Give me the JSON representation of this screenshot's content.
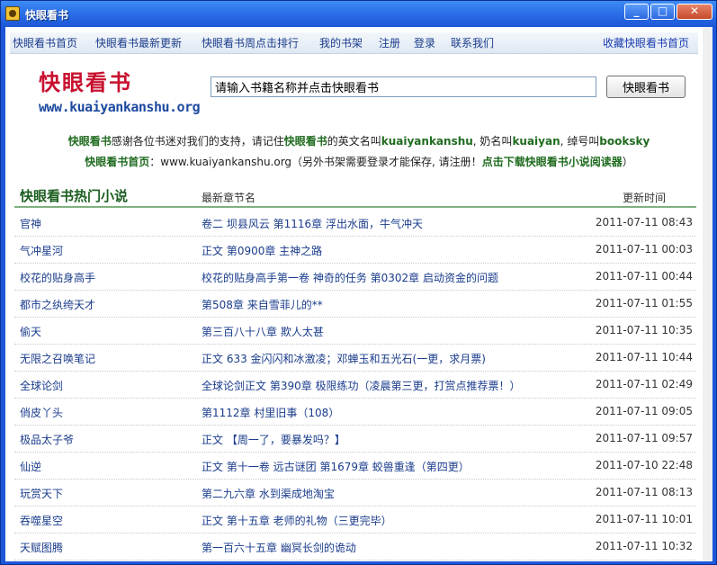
{
  "window": {
    "title": "快眼看书"
  },
  "nav": {
    "items": [
      "快眼看书首页",
      "快眼看书最新更新",
      "快眼看书周点击排行",
      "我的书架",
      "注册",
      "登录",
      "联系我们"
    ],
    "favorite": "收藏快眼看书首页"
  },
  "logo": {
    "text": "快眼看书",
    "url": "www.kuaiyankanshu.org"
  },
  "search": {
    "value": "请输入书籍名称并点击快眼看书",
    "button": "快眼看书"
  },
  "notice": {
    "line1": {
      "b1": "快眼看书",
      "t1": "感谢各位书迷对我们的支持，请记住",
      "b2": "快眼看书",
      "t2": "的英文名叫",
      "b3": "kuaiyankanshu",
      "t3": ", 奶名叫",
      "b4": "kuaiyan",
      "t4": ", 绰号叫",
      "b5": "booksky"
    },
    "line2": {
      "b1": "快眼看书首页",
      "t1": "：www.kuaiyankanshu.org（另外书架需要登录才能保存, 请注册！",
      "b2": "点击下载快眼看书小说阅读器",
      "t2": "）"
    }
  },
  "list": {
    "title": "快眼看书热门小说",
    "col_chapter": "最新章节名",
    "col_time": "更新时间",
    "rows": [
      {
        "name": "官神",
        "chapter": "卷二 坝县风云 第1116章 浮出水面，牛气冲天",
        "time": "2011-07-11 08:43"
      },
      {
        "name": "气冲星河",
        "chapter": "正文 第0900章 主神之路",
        "time": "2011-07-11 00:03"
      },
      {
        "name": "校花的贴身高手",
        "chapter": "校花的贴身高手第一卷 神奇的任务 第0302章 启动资金的问题",
        "time": "2011-07-11 00:44"
      },
      {
        "name": "都市之纨绔天才",
        "chapter": "第508章 来自雪菲儿的**",
        "time": "2011-07-11 01:55"
      },
      {
        "name": "偷天",
        "chapter": "第三百八十八章 欺人太甚",
        "time": "2011-07-11 10:35"
      },
      {
        "name": "无限之召唤笔记",
        "chapter": "正文 633 金闪闪和冰激凌；邓蝉玉和五光石(一更，求月票)",
        "time": "2011-07-11 10:44"
      },
      {
        "name": "全球论剑",
        "chapter": "全球论剑正文 第390章 极限练功（凌晨第三更，打赏点推荐票！）",
        "time": "2011-07-11 02:49"
      },
      {
        "name": "俏皮丫头",
        "chapter": "第1112章 村里旧事（108）",
        "time": "2011-07-11 09:05"
      },
      {
        "name": "极品太子爷",
        "chapter": "正文 【周一了，要暴发吗？】",
        "time": "2011-07-11 09:57"
      },
      {
        "name": "仙逆",
        "chapter": "正文 第十一卷 远古谜团 第1679章 蛟兽重逢（第四更）",
        "time": "2011-07-10 22:48"
      },
      {
        "name": "玩赏天下",
        "chapter": "第二九六章 水到渠成地淘宝",
        "time": "2011-07-11 08:13"
      },
      {
        "name": "吞噬星空",
        "chapter": "正文 第十五章 老师的礼物（三更完毕）",
        "time": "2011-07-11 10:01"
      },
      {
        "name": "天赋图腾",
        "chapter": "第一百六十五章 幽冥长剑的诡动",
        "time": "2011-07-11 10:32"
      }
    ]
  }
}
